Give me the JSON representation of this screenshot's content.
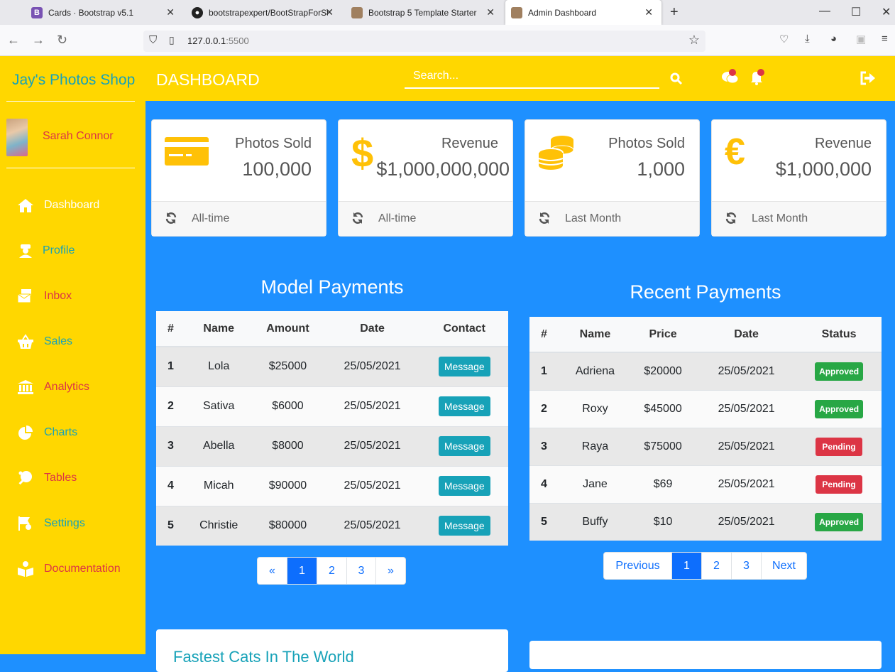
{
  "browser": {
    "tabs": [
      {
        "title": "Cards · Bootstrap v5.1",
        "fav": "B",
        "fav_color": "#7952b3"
      },
      {
        "title": "bootstrapexpert/BootStrapForSt",
        "fav": "gh",
        "fav_color": "#222222"
      },
      {
        "title": "Bootstrap 5 Template Starter",
        "fav": "img",
        "fav_color": "#a08060"
      },
      {
        "title": "Admin Dashboard",
        "fav": "img",
        "fav_color": "#a08060"
      }
    ],
    "url_host": "127.0.0.1",
    "url_port": ":5500"
  },
  "sidebar": {
    "brand": "Jay's Photos Shop",
    "user": "Sarah Connor",
    "items": [
      {
        "label": "Dashboard",
        "icon": "home-icon",
        "color": "#ffffff"
      },
      {
        "label": "Profile",
        "icon": "user-badge-icon",
        "color": "#17a2b8"
      },
      {
        "label": "Inbox",
        "icon": "inbox-icon",
        "color": "#dc3545"
      },
      {
        "label": "Sales",
        "icon": "basket-icon",
        "color": "#17a2b8"
      },
      {
        "label": "Analytics",
        "icon": "bank-icon",
        "color": "#dc3545"
      },
      {
        "label": "Charts",
        "icon": "pie-chart-icon",
        "color": "#17a2b8"
      },
      {
        "label": "Tables",
        "icon": "table-tennis-icon",
        "color": "#dc3545"
      },
      {
        "label": "Settings",
        "icon": "settings-flag-icon",
        "color": "#17a2b8"
      },
      {
        "label": "Documentation",
        "icon": "book-reader-icon",
        "color": "#dc3545"
      }
    ]
  },
  "header": {
    "title": "DASHBOARD",
    "search_placeholder": "Search..."
  },
  "cards": [
    {
      "title": "Photos Sold",
      "value": "100,000",
      "footer": "All-time",
      "icon": "credit-card-icon"
    },
    {
      "title": "Revenue",
      "value": "$1,000,000,000",
      "footer": "All-time",
      "icon": "dollar-icon"
    },
    {
      "title": "Photos Sold",
      "value": "1,000",
      "footer": "Last Month",
      "icon": "coins-icon"
    },
    {
      "title": "Revenue",
      "value": "$1,000,000",
      "footer": "Last Month",
      "icon": "euro-icon"
    }
  ],
  "model_payments": {
    "title": "Model Payments",
    "headers": [
      "#",
      "Name",
      "Amount",
      "Date",
      "Contact"
    ],
    "rows": [
      {
        "n": "1",
        "name": "Lola",
        "amount": "$25000",
        "date": "25/05/2021",
        "action": "Message"
      },
      {
        "n": "2",
        "name": "Sativa",
        "amount": "$6000",
        "date": "25/05/2021",
        "action": "Message"
      },
      {
        "n": "3",
        "name": "Abella",
        "amount": "$8000",
        "date": "25/05/2021",
        "action": "Message"
      },
      {
        "n": "4",
        "name": "Micah",
        "amount": "$90000",
        "date": "25/05/2021",
        "action": "Message"
      },
      {
        "n": "5",
        "name": "Christie",
        "amount": "$80000",
        "date": "25/05/2021",
        "action": "Message"
      }
    ],
    "pager": [
      "«",
      "1",
      "2",
      "3",
      "»"
    ]
  },
  "recent_payments": {
    "title": "Recent Payments",
    "headers": [
      "#",
      "Name",
      "Price",
      "Date",
      "Status"
    ],
    "rows": [
      {
        "n": "1",
        "name": "Adriena",
        "price": "$20000",
        "date": "25/05/2021",
        "status": "Approved"
      },
      {
        "n": "2",
        "name": "Roxy",
        "price": "$45000",
        "date": "25/05/2021",
        "status": "Approved"
      },
      {
        "n": "3",
        "name": "Raya",
        "price": "$75000",
        "date": "25/05/2021",
        "status": "Pending"
      },
      {
        "n": "4",
        "name": "Jane",
        "price": "$69",
        "date": "25/05/2021",
        "status": "Pending"
      },
      {
        "n": "5",
        "name": "Buffy",
        "price": "$10",
        "date": "25/05/2021",
        "status": "Approved"
      }
    ],
    "pager": [
      "Previous",
      "1",
      "2",
      "3",
      "Next"
    ]
  },
  "bottom": {
    "heading": "Fastest Cats In The World"
  },
  "colors": {
    "sidebar": "#ffd700",
    "content": "#1e90ff",
    "approved": "#28a745",
    "pending": "#dc3545",
    "teal": "#17a2b8",
    "primary": "#0d6efd"
  }
}
